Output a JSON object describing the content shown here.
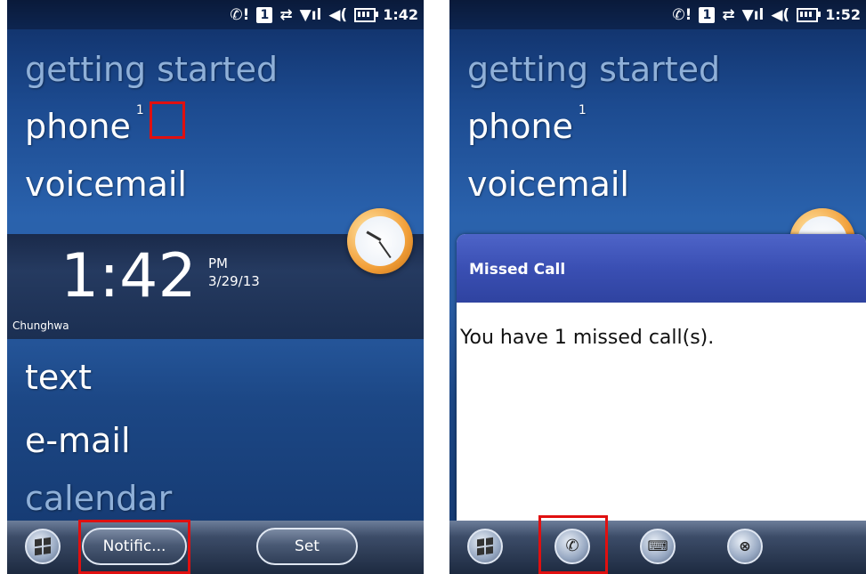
{
  "left": {
    "status": {
      "time": "1:42"
    },
    "menu": [
      "getting started",
      "phone",
      "voicemail",
      "text",
      "e-mail",
      "calendar"
    ],
    "phone_badge": "1",
    "clock": {
      "time": "1:42",
      "ampm": "PM",
      "date": "3/29/13",
      "carrier": "Chunghwa"
    },
    "softkeys": {
      "left": "Notific...",
      "right": "Set"
    }
  },
  "right": {
    "status": {
      "time": "1:52"
    },
    "menu": [
      "getting started",
      "phone",
      "voicemail"
    ],
    "phone_badge": "1",
    "dialog": {
      "title": "Missed Call",
      "message": "You have 1 missed call(s)."
    }
  },
  "icons": {
    "status": [
      "missed-call-icon",
      "sim-1-icon",
      "data-sync-icon",
      "signal-icon",
      "volume-icon",
      "battery-icon"
    ],
    "softbar_right": [
      "start-icon",
      "missed-call-icon",
      "keyboard-icon",
      "dismiss-notification-icon"
    ]
  },
  "colors": {
    "highlight": "#e01010",
    "dialog_header": "#3a4fb3"
  }
}
